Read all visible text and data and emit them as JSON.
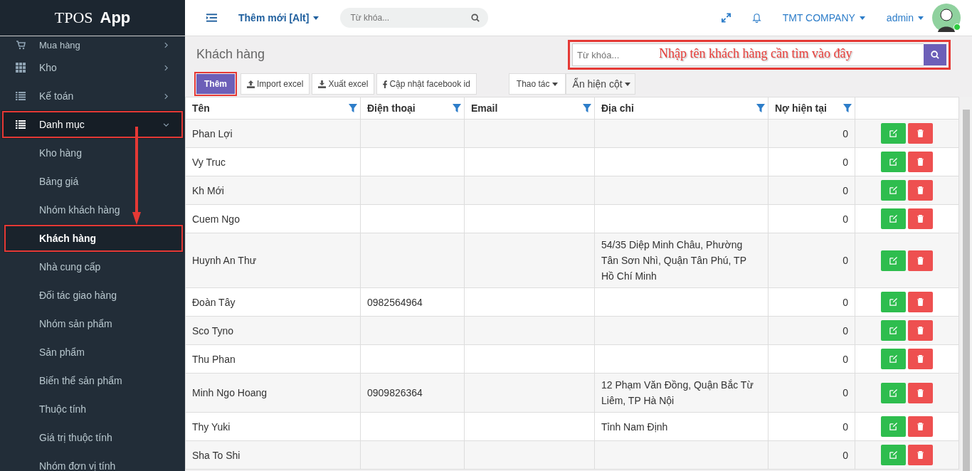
{
  "app": {
    "logo_light": "TPOS",
    "logo_bold": "App"
  },
  "topbar": {
    "new_menu": "Thêm mới [Alt]",
    "search": {
      "placeholder": "Từ khóa..."
    },
    "company": "TMT COMPANY",
    "user": "admin",
    "online": true
  },
  "sidebar": {
    "items": [
      {
        "label": "Mua hàng",
        "expanded": false,
        "selected": false
      },
      {
        "label": "Kho",
        "expanded": false,
        "selected": false
      },
      {
        "label": "Kế toán",
        "expanded": false,
        "selected": false
      },
      {
        "label": "Danh mục",
        "expanded": true,
        "selected": true,
        "children": [
          {
            "label": "Kho hàng",
            "selected": false
          },
          {
            "label": "Bảng giá",
            "selected": false
          },
          {
            "label": "Nhóm khách hàng",
            "selected": false
          },
          {
            "label": "Khách hàng",
            "selected": true
          },
          {
            "label": "Nhà cung cấp",
            "selected": false
          },
          {
            "label": "Đối tác giao hàng",
            "selected": false
          },
          {
            "label": "Nhóm sản phẩm",
            "selected": false
          },
          {
            "label": "Sản phẩm",
            "selected": false
          },
          {
            "label": "Biến thể sản phẩm",
            "selected": false
          },
          {
            "label": "Thuộc tính",
            "selected": false
          },
          {
            "label": "Giá trị thuộc tính",
            "selected": false
          },
          {
            "label": "Nhóm đơn vị tính",
            "selected": false
          }
        ]
      }
    ]
  },
  "page": {
    "title": "Khách hàng",
    "search": {
      "placeholder": "Từ khóa..."
    },
    "toolbar": [
      {
        "label": "Thêm",
        "kind": "primary"
      },
      {
        "label": "Import excel",
        "kind": "upload"
      },
      {
        "label": "Xuất excel",
        "kind": "download"
      },
      {
        "label": "Cập nhật facebook id",
        "kind": "facebook"
      }
    ],
    "actions": [
      {
        "label": "Thao tác",
        "kind": "small"
      },
      {
        "label": "Ẩn hiện cột",
        "kind": "large"
      }
    ]
  },
  "annotations": {
    "search_hint": "Nhập tên khách hàng cần tìm vào đây"
  },
  "table": {
    "columns": [
      "Tên",
      "Điện thoại",
      "Email",
      "Địa chỉ",
      "Nợ hiện tại"
    ],
    "rows": [
      {
        "name": "Phan Lợi",
        "phone": "",
        "email": "",
        "address": "",
        "debt": "0"
      },
      {
        "name": "Vy Truc",
        "phone": "",
        "email": "",
        "address": "",
        "debt": "0"
      },
      {
        "name": "Kh Mới",
        "phone": "",
        "email": "",
        "address": "",
        "debt": "0"
      },
      {
        "name": "Cuem Ngo",
        "phone": "",
        "email": "",
        "address": "",
        "debt": "0"
      },
      {
        "name": "Huynh An Thư",
        "phone": "",
        "email": "",
        "address": "54/35 Diệp Minh Châu, Phường Tân Sơn Nhì, Quận Tân Phú, TP Hồ Chí Minh",
        "debt": "0"
      },
      {
        "name": "Đoàn Tây",
        "phone": "0982564964",
        "email": "",
        "address": "",
        "debt": "0"
      },
      {
        "name": "Sco Tyno",
        "phone": "",
        "email": "",
        "address": "",
        "debt": "0"
      },
      {
        "name": "Thu Phan",
        "phone": "",
        "email": "",
        "address": "",
        "debt": "0"
      },
      {
        "name": "Minh Ngo Hoang",
        "phone": "0909826364",
        "email": "",
        "address": "12 Phạm Văn Đồng, Quận Bắc Từ Liêm, TP Hà Nội",
        "debt": "0"
      },
      {
        "name": "Thy Yuki",
        "phone": "",
        "email": "",
        "address": "Tỉnh Nam Định",
        "debt": "0"
      },
      {
        "name": "Sha To Shi",
        "phone": "",
        "email": "",
        "address": "",
        "debt": "0"
      }
    ]
  }
}
